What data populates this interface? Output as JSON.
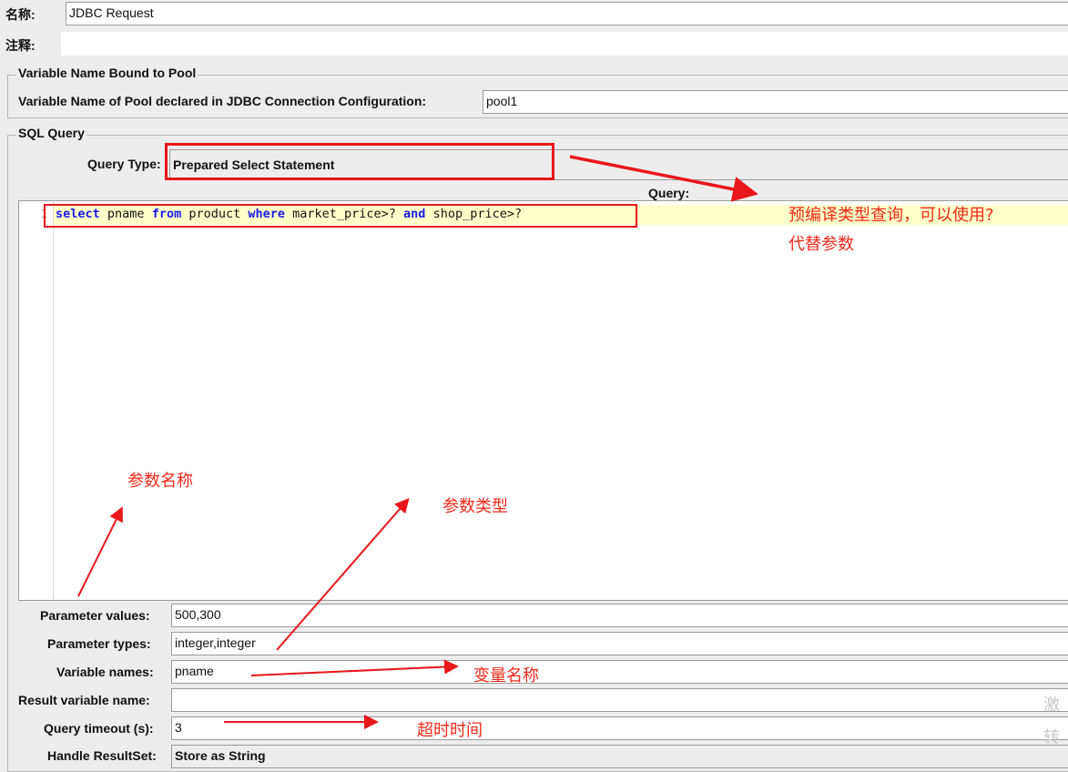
{
  "name_row": {
    "label": "名称:",
    "value": "JDBC Request"
  },
  "comment_row": {
    "label": "注释:",
    "value": ""
  },
  "pool_group": {
    "legend": "Variable Name Bound to Pool",
    "label": "Variable Name of Pool declared in JDBC Connection Configuration:",
    "value": "pool1"
  },
  "sql_group": {
    "legend": "SQL Query",
    "query_type_label": "Query Type:",
    "query_type_value": "Prepared Select Statement",
    "query_label": "Query:",
    "line_number": "1",
    "code": {
      "kw_select": "select",
      "t1": " pname ",
      "kw_from": "from",
      "t2": " product ",
      "kw_where": "where",
      "t3": " market_price>? ",
      "kw_and": "and",
      "t4": " shop_price>?"
    }
  },
  "params": {
    "values_label": "Parameter values:",
    "values_value": "500,300",
    "types_label": "Parameter types:",
    "types_value": "integer,integer",
    "names_label": "Variable names:",
    "names_value": "pname",
    "result_label": "Result variable name:",
    "result_value": "",
    "timeout_label": "Query timeout (s):",
    "timeout_value": "3",
    "resultset_label": "Handle ResultSet:",
    "resultset_value": "Store as String"
  },
  "annotations": {
    "prepared": "预编译类型查询，可以使用?",
    "prepared2": "代替参数",
    "param_name": "参数名称",
    "param_type": "参数类型",
    "var_name": "变量名称",
    "timeout": "超时时间"
  },
  "watermark": {
    "line1": "激",
    "line2": "转"
  },
  "colors": {
    "annotation_red": "#e8171b",
    "keyword_blue": "#1a1ae6",
    "highlight_yellow": "#ffffc8"
  }
}
